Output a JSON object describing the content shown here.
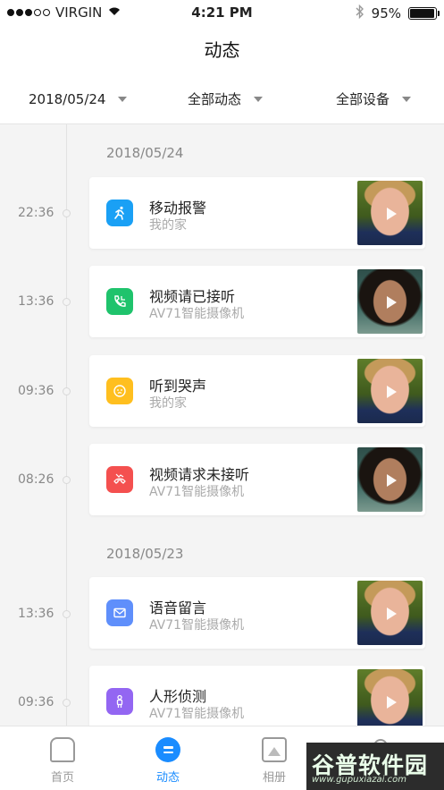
{
  "status_bar": {
    "carrier": "VIRGIN",
    "time": "4:21 PM",
    "battery": "95%",
    "battery_level": 0.95
  },
  "header": {
    "title": "动态"
  },
  "filters": {
    "date": "2018/05/24",
    "type": "全部动态",
    "device": "全部设备"
  },
  "groups": [
    {
      "date": "2018/05/24",
      "events": [
        {
          "time": "22:36",
          "title": "移动报警",
          "subtitle": "我的家",
          "icon": "running-person-icon",
          "color": "#1aa0f5",
          "thumb": "boy"
        },
        {
          "time": "13:36",
          "title": "视频请已接听",
          "subtitle": "AV71智能摄像机",
          "icon": "phone-answered-icon",
          "color": "#1fc36c",
          "thumb": "girl"
        },
        {
          "time": "09:36",
          "title": "听到哭声",
          "subtitle": "我的家",
          "icon": "baby-face-icon",
          "color": "#ffbf1f",
          "thumb": "boy"
        },
        {
          "time": "08:26",
          "title": "视频请求未接听",
          "subtitle": "AV71智能摄像机",
          "icon": "phone-missed-icon",
          "color": "#f4504f",
          "thumb": "girl"
        }
      ]
    },
    {
      "date": "2018/05/23",
      "events": [
        {
          "time": "13:36",
          "title": "语音留言",
          "subtitle": "AV71智能摄像机",
          "icon": "mail-icon",
          "color": "#5f8ffb",
          "thumb": "boy"
        },
        {
          "time": "09:36",
          "title": "人形侦测",
          "subtitle": "AV71智能摄像机",
          "icon": "person-icon",
          "color": "#9366f2",
          "thumb": "boy"
        }
      ]
    }
  ],
  "tabs": [
    {
      "label": "首页",
      "icon": "home-icon",
      "active": false
    },
    {
      "label": "动态",
      "icon": "feed-icon",
      "active": true
    },
    {
      "label": "相册",
      "icon": "album-icon",
      "active": false
    }
  ],
  "watermark": {
    "main": "谷普软件园",
    "url": "www.gupuxiazai.com"
  }
}
